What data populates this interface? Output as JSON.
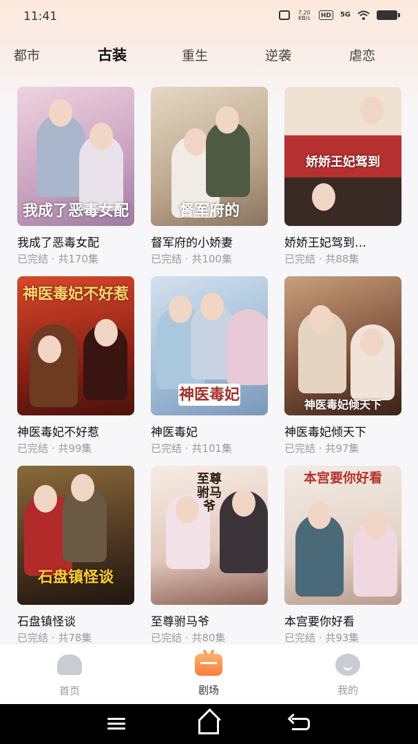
{
  "status_bar": {
    "time": "11:41",
    "speed_top": "7.20",
    "speed_unit": "KB/s",
    "hd": "HD",
    "signal": "5G"
  },
  "tabs": [
    "都市",
    "古装",
    "重生",
    "逆袭",
    "虐恋"
  ],
  "active_tab": "古装",
  "dramas": [
    {
      "title": "我成了恶毒女配",
      "status": "已完结",
      "episodes": "共170集",
      "poster_text": "我成了恶毒女配",
      "color_a": "#e8c7d6",
      "color_b": "#b88fb0"
    },
    {
      "title": "督军府的小娇妻",
      "status": "已完结",
      "episodes": "共100集",
      "poster_text": "督军府的",
      "color_a": "#d9c9b1",
      "color_b": "#7d6a55"
    },
    {
      "title": "娇娇王妃驾到…",
      "status": "已完结",
      "episodes": "共88集",
      "poster_text": "娇娇王妃驾到",
      "color_a": "#e6d3bf",
      "color_b": "#b5302e"
    },
    {
      "title": "神医毒妃不好惹",
      "status": "已完结",
      "episodes": "共99集",
      "poster_text": "神医毒妃不好惹",
      "color_a": "#c8361f",
      "color_b": "#5a1810"
    },
    {
      "title": "神医毒妃",
      "status": "已完结",
      "episodes": "共101集",
      "poster_text": "神医毒妃",
      "color_a": "#bcd2e4",
      "color_b": "#7fa3c4"
    },
    {
      "title": "神医毒妃倾天下",
      "status": "已完结",
      "episodes": "共97集",
      "poster_text": "神医毒妃倾天下",
      "color_a": "#b58a6a",
      "color_b": "#4e2e24"
    },
    {
      "title": "石盘镇怪谈",
      "status": "已完结",
      "episodes": "共78集",
      "poster_text": "石盘镇怪谈",
      "color_a": "#8a6a3a",
      "color_b": "#2b2016"
    },
    {
      "title": "至尊驸马爷",
      "status": "已完结",
      "episodes": "共80集",
      "poster_text": "至尊驸马爷",
      "color_a": "#f2e4dc",
      "color_b": "#9a6f62"
    },
    {
      "title": "本宫要你好看",
      "status": "已完结",
      "episodes": "共93集",
      "poster_text": "本宫要你好看",
      "color_a": "#efe6df",
      "color_b": "#b4493a"
    }
  ],
  "bottom_nav": [
    {
      "label": "首页",
      "icon": "home-icon"
    },
    {
      "label": "剧场",
      "icon": "theater-icon"
    },
    {
      "label": "我的",
      "icon": "profile-icon"
    }
  ],
  "bottom_nav_active": "剧场",
  "accent": "#ff7a3c"
}
